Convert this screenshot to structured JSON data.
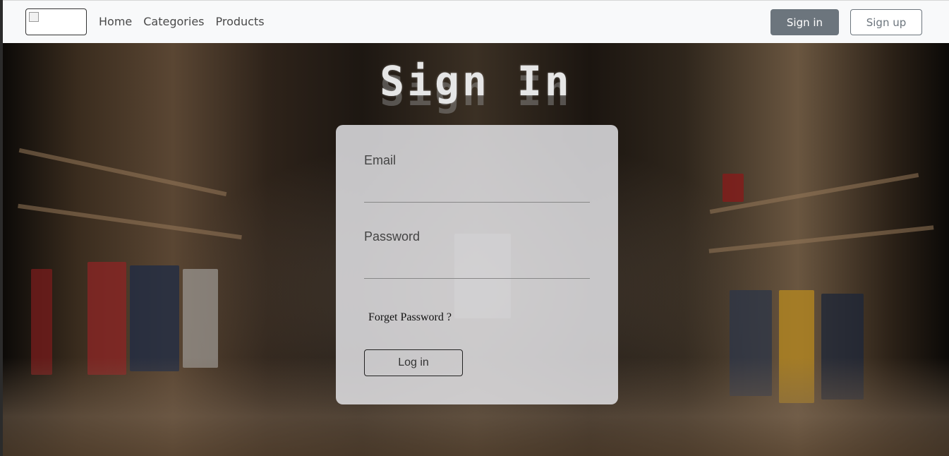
{
  "navbar": {
    "links": [
      "Home",
      "Categories",
      "Products"
    ],
    "signin_label": "Sign in",
    "signup_label": "Sign up"
  },
  "hero": {
    "title": "Sign In"
  },
  "form": {
    "email_label": "Email",
    "password_label": "Password",
    "forget_label": "Forget Password ?",
    "login_label": "Log in"
  }
}
